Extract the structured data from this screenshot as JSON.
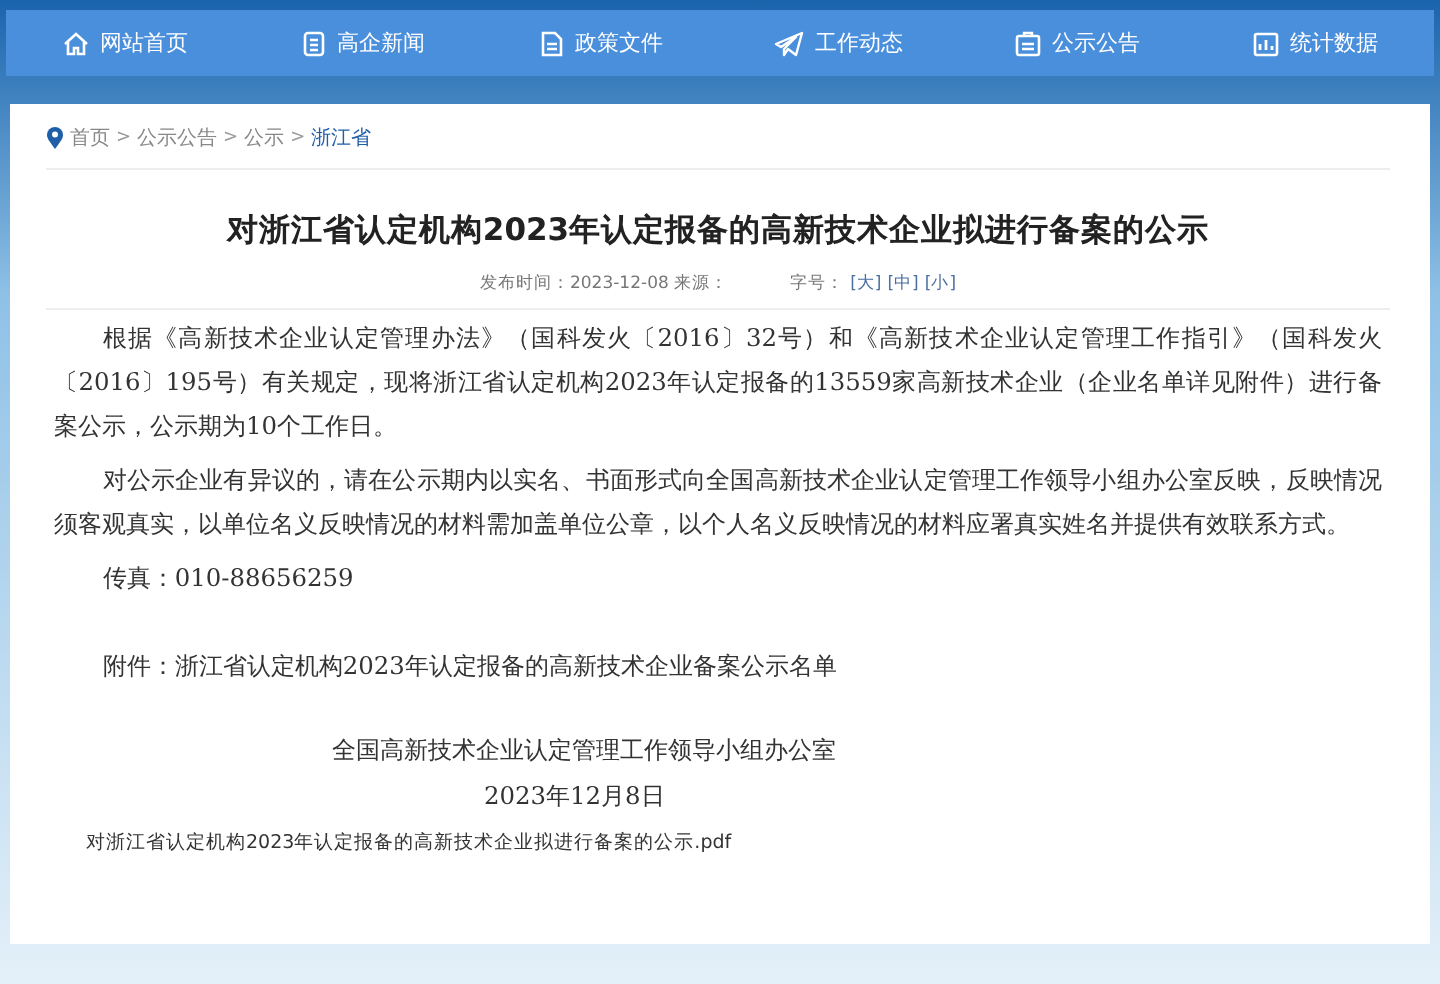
{
  "nav": [
    {
      "label": "网站首页"
    },
    {
      "label": "高企新闻"
    },
    {
      "label": "政策文件"
    },
    {
      "label": "工作动态"
    },
    {
      "label": "公示公告"
    },
    {
      "label": "统计数据"
    }
  ],
  "breadcrumb": [
    {
      "label": "首页",
      "selected": false
    },
    {
      "label": "公示公告",
      "selected": false
    },
    {
      "label": "公示",
      "selected": false
    },
    {
      "label": "浙江省",
      "selected": true
    }
  ],
  "breadcrumb_separator": ">",
  "article": {
    "title": "对浙江省认定机构2023年认定报备的高新技术企业拟进行备案的公示",
    "meta": {
      "published": "发布时间：2023-12-08 来源：",
      "font_size_label": "字号：",
      "font_sizes": [
        {
          "label": "[大]"
        },
        {
          "label": "[中]"
        },
        {
          "label": "[小]"
        }
      ]
    },
    "paragraphs": [
      "根据《高新技术企业认定管理办法》（国科发火〔2016〕32号）和《高新技术企业认定管理工作指引》（国科发火〔2016〕195号）有关规定，现将浙江省认定机构2023年认定报备的13559家高新技术企业（企业名单详见附件）进行备案公示，公示期为10个工作日。",
      "对公示企业有异议的，请在公示期内以实名、书面形式向全国高新技术企业认定管理工作领导小组办公室反映，反映情况须客观真实，以单位名义反映情况的材料需加盖单位公章，以个人名义反映情况的材料应署真实姓名并提供有效联系方式。",
      "传真：010-88656259"
    ],
    "attachment": "附件：浙江省认定机构2023年认定报备的高新技术企业备案公示名单",
    "signature": "全国高新技术企业认定管理工作领导小组办公室",
    "date": "2023年12月8日",
    "file_link": "对浙江省认定机构2023年认定报备的高新技术企业拟进行备案的公示.pdf"
  }
}
